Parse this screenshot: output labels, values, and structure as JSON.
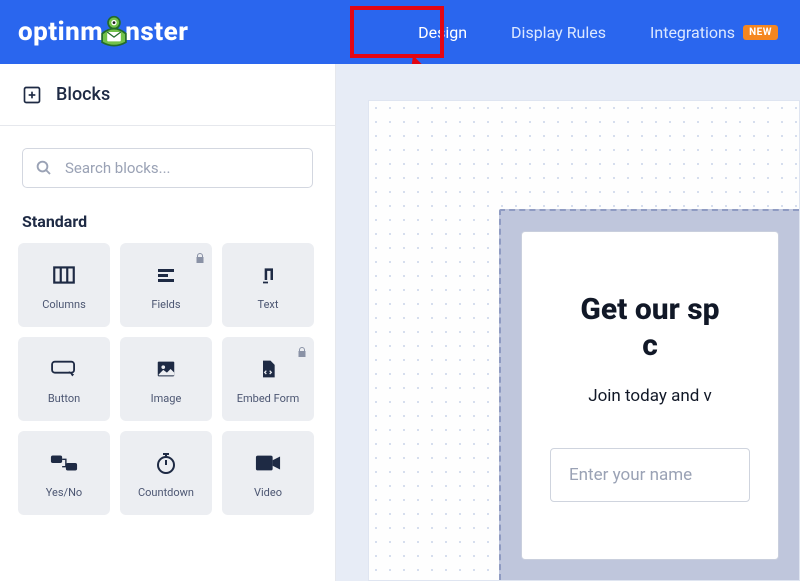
{
  "brand": {
    "name_left": "optinm",
    "name_right": "nster"
  },
  "nav": {
    "design": "Design",
    "display_rules": "Display Rules",
    "integrations": "Integrations",
    "badge_new": "NEW"
  },
  "sidebar": {
    "title": "Blocks",
    "search_placeholder": "Search blocks...",
    "section_standard": "Standard",
    "blocks": [
      {
        "label": "Columns",
        "icon": "columns",
        "locked": false
      },
      {
        "label": "Fields",
        "icon": "fields",
        "locked": true
      },
      {
        "label": "Text",
        "icon": "text",
        "locked": false
      },
      {
        "label": "Button",
        "icon": "button",
        "locked": false
      },
      {
        "label": "Image",
        "icon": "image",
        "locked": false
      },
      {
        "label": "Embed Form",
        "icon": "embed",
        "locked": true
      },
      {
        "label": "Yes/No",
        "icon": "yesno",
        "locked": false
      },
      {
        "label": "Countdown",
        "icon": "countdown",
        "locked": false
      },
      {
        "label": "Video",
        "icon": "video",
        "locked": false
      }
    ]
  },
  "preview": {
    "heading_line1": "Get our sp",
    "heading_line2": "c",
    "subheading": "Join today and v",
    "name_placeholder": "Enter your name"
  },
  "annotation": {
    "highlight_target": "nav-design",
    "arrow": true
  }
}
